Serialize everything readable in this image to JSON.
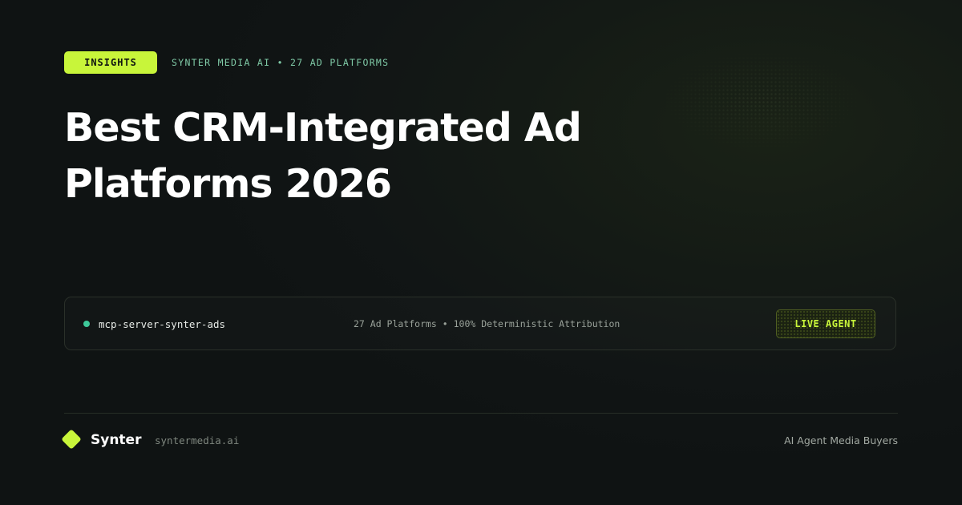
{
  "header": {
    "badge_label": "INSIGHTS",
    "meta_text": "SYNTER MEDIA AI • 27 AD PLATFORMS"
  },
  "title": {
    "line1": "Best CRM-Integrated Ad",
    "line2": "Platforms 2026"
  },
  "terminal": {
    "status_color": "#3ec99a",
    "server_name": "mcp-server-synter-ads",
    "stats": "27 Ad Platforms • 100% Deterministic Attribution",
    "action_label": "LIVE AGENT"
  },
  "footer": {
    "logo_icon": "diamond-logo-icon",
    "brand_name": "Synter",
    "domain": "syntermedia.ai",
    "tagline": "AI Agent Media Buyers"
  },
  "colors": {
    "accent": "#c8f53a",
    "meta_text": "#7fc9a6",
    "background": "#111515"
  }
}
